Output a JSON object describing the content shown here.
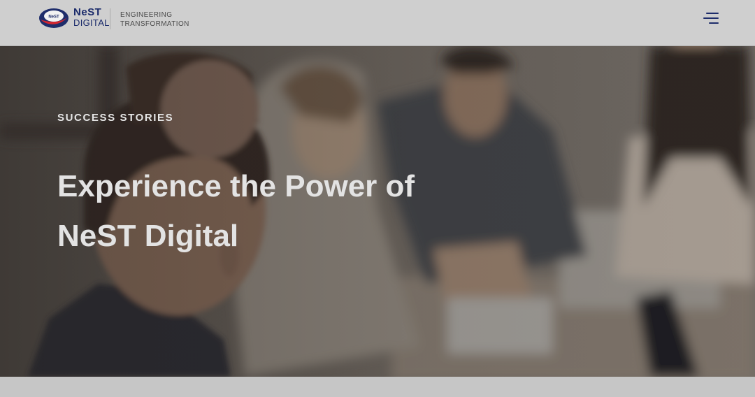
{
  "header": {
    "logo": {
      "line1": "NeST",
      "line2": "DIGITAL",
      "mark_text": "NeST"
    },
    "tagline": {
      "line1": "ENGINEERING",
      "line2": "TRANSFORMATION"
    },
    "menu_icon": "hamburger-menu-icon"
  },
  "hero": {
    "eyebrow": "SUCCESS STORIES",
    "headline": "Experience the Power of NeST Digital",
    "image": "team-meeting-photo"
  },
  "colors": {
    "brand_navy": "#1e2d6b",
    "brand_red": "#d3262f",
    "header_bg": "#cfcfcf"
  }
}
